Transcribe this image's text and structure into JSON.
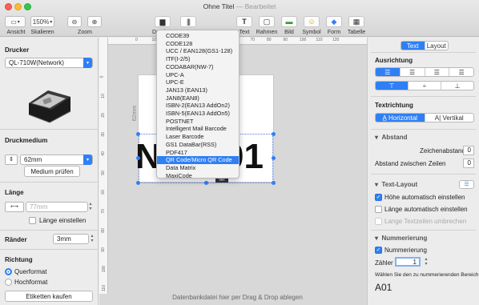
{
  "window": {
    "title": "Ohne Titel",
    "subtitle": "— Bearbeitet"
  },
  "toolbar": {
    "view_label": "Ansicht",
    "scale_label": "Skalieren",
    "zoom_value": "150%",
    "zoom_label": "Zoom",
    "print_label": "Drucken",
    "text_label": "Text",
    "frame_label": "Rahmen",
    "image_label": "Bild",
    "symbol_label": "Symbol",
    "form_label": "Form",
    "table_label": "Tabelle"
  },
  "left": {
    "printer_header": "Drucker",
    "printer_value": "QL-710W(Network)",
    "media_header": "Druckmedium",
    "media_value": "62mm",
    "check_media_button": "Medium prüfen",
    "length_header": "Länge",
    "length_value": "77mm",
    "set_length_label": "Länge einstellen",
    "margins_label": "Ränder",
    "margins_value": "3mm",
    "direction_header": "Richtung",
    "landscape_label": "Querformat",
    "portrait_label": "Hochformat",
    "buy_labels_button": "Etiketten kaufen"
  },
  "canvas": {
    "ruler_unit": "mm",
    "side_label": "62mm",
    "big_text": "N",
    "big_text_right": "01",
    "mini_tag": "NR",
    "dropzone": "Datenbankdatei hier per Drag & Drop ablegen",
    "hruler_ticks": [
      "0",
      "10",
      "20",
      "30",
      "40",
      "50",
      "60",
      "70",
      "80",
      "90",
      "100",
      "110",
      "120"
    ],
    "vruler_ticks": [
      "0",
      "10",
      "20",
      "30",
      "40",
      "50",
      "60",
      "70",
      "80",
      "90",
      "100",
      "110"
    ]
  },
  "barcode_menu": {
    "items": [
      "CODE39",
      "CODE128",
      "UCC / EAN128(GS1-128)",
      "ITF(I-2/5)",
      "CODABAR(NW-7)",
      "UPC-A",
      "UPC-E",
      "JAN13 (EAN13)",
      "JAN8(EAN8)",
      "ISBN-2(EAN13 AddOn2)",
      "ISBN-5(EAN13 AddOn5)",
      "POSTNET",
      "Intelligent Mail Barcode",
      "Laser Barcode",
      "GS1 DataBar(RSS)",
      "PDF417",
      "QR Code/Micro QR Code",
      "Data Matrix",
      "MaxiCode"
    ],
    "selected": "QR Code/Micro QR Code"
  },
  "right": {
    "tab_text": "Text",
    "tab_layout": "Layout",
    "alignment_header": "Ausrichtung",
    "text_direction_header": "Textrichtung",
    "horizontal_label": "Horizontal",
    "vertical_label": "Vertikal",
    "spacing_header": "Abstand",
    "char_spacing_label": "Zeichenabstand",
    "char_spacing_value": "0",
    "line_spacing_label": "Abstand zwischen Zeilen",
    "line_spacing_value": "0",
    "text_layout_header": "Text-Layout",
    "auto_height_label": "Höhe automatisch einstellen",
    "auto_length_label": "Länge automatisch einstellen",
    "wrap_label": "Lange Textzeilen umbrechen",
    "numbering_header": "Nummerierung",
    "numbering_label": "Nummerierung",
    "counter_label": "Zähler",
    "counter_value": "1",
    "choose_range_label": "Wählen Sie den zu nummerierenden Bereich",
    "range_preview": "A01"
  },
  "colors": {
    "accent": "#2f7ff5",
    "close": "#fc5f57",
    "minimize": "#fdbc2e",
    "maximize": "#34c84a"
  }
}
